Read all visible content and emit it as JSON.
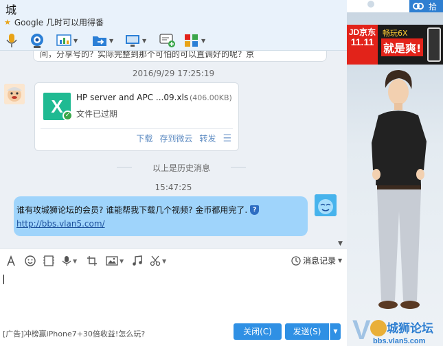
{
  "header": {
    "contact_name": "城",
    "signature": "Google 几时可以用得番",
    "top_right_tab": "拾"
  },
  "toolbar": {
    "items": [
      {
        "icon": "microphone-icon"
      },
      {
        "icon": "video-camera-icon"
      },
      {
        "icon": "whiteboard-icon"
      },
      {
        "icon": "send-file-icon"
      },
      {
        "icon": "remote-desktop-icon"
      },
      {
        "icon": "add-chat-icon"
      },
      {
        "icon": "apps-icon"
      }
    ]
  },
  "chat": {
    "old_message_partial": "间，分享号的？实际完整到那个可怕的可以直调好的呢？京",
    "timestamp1": "2016/9/29 17:25:19",
    "file_card": {
      "name": "HP server and APC ...09.xls",
      "size": "(406.00KB)",
      "status": "文件已过期",
      "actions": [
        "下载",
        "存到微云",
        "转发"
      ]
    },
    "history_separator": "以上是历史消息",
    "timestamp2": "15:47:25",
    "my_message": {
      "text": "谁有攻城狮论坛的会员? 谁能帮我下载几个视频? 金币都用完了.",
      "link": "http://bbs.vlan5.com/"
    }
  },
  "input_toolbar": {
    "history_label": "消息记录"
  },
  "bottom": {
    "ad_text": "[广告]冲榜赢iPhone7+30倍收益!怎么玩?",
    "close_label": "关闭(C)",
    "send_label": "发送(S)"
  },
  "right_panel": {
    "ad_brand": "JD京东",
    "ad_brand_sub": "11.11",
    "ad_slogan1": "畅玩6X",
    "ad_slogan2": "就是爽!",
    "watermark_text": "城狮论坛",
    "watermark_url": "bbs.vlan5.com"
  },
  "colors": {
    "accent": "#2f90e4",
    "my_bubble": "#9fd4fb",
    "chat_bg": "#ecf0f5",
    "file_icon": "#1fba92"
  }
}
